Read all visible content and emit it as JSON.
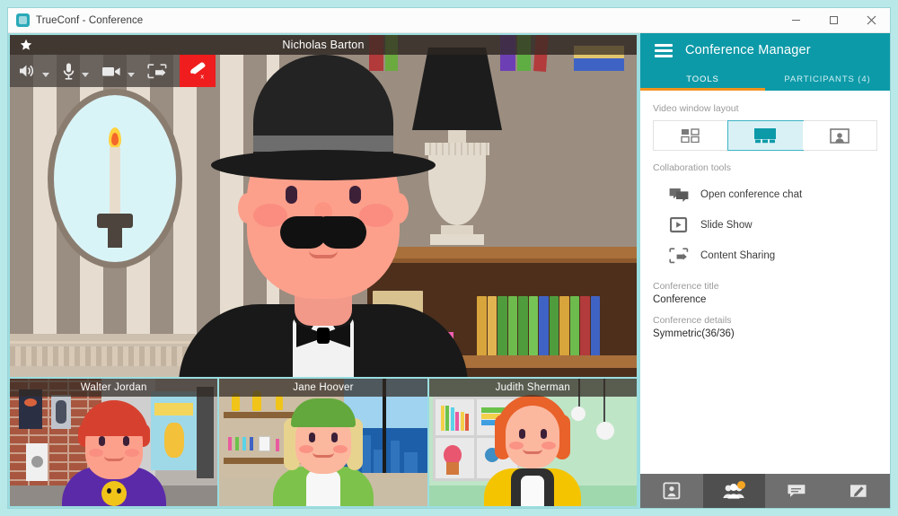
{
  "window": {
    "app_icon": "trueconf-logo-icon",
    "title": "TrueConf - Conference",
    "minimize_label": "–",
    "maximize_label": "□",
    "close_label": "✕"
  },
  "video_toolbar": {
    "star_icon": "star-icon",
    "speaker_icon": "speaker-icon",
    "microphone_icon": "microphone-icon",
    "camera_icon": "camera-icon",
    "screen_share_icon": "screen-share-icon",
    "hangup_icon": "hangup-icon"
  },
  "main_video": {
    "participant_name": "Nicholas Barton"
  },
  "thumbnails": [
    {
      "name": "Walter Jordan"
    },
    {
      "name": "Jane Hoover"
    },
    {
      "name": "Judith Sherman"
    }
  ],
  "conference_manager": {
    "menu_icon": "hamburger-menu-icon",
    "title": "Conference Manager",
    "tabs": [
      {
        "label": "TOOLS",
        "active": true
      },
      {
        "label": "PARTICIPANTS (4)",
        "active": false
      }
    ],
    "video_layout": {
      "section_label": "Video window layout",
      "options": [
        {
          "name": "layout-grid-icon",
          "selected": false
        },
        {
          "name": "layout-podium-icon",
          "selected": true
        },
        {
          "name": "layout-single-icon",
          "selected": false
        }
      ]
    },
    "collaboration": {
      "section_label": "Collaboration tools",
      "items": [
        {
          "label": "Open conference chat",
          "icon": "chat-icon"
        },
        {
          "label": "Slide Show",
          "icon": "slideshow-icon"
        },
        {
          "label": "Content Sharing",
          "icon": "content-sharing-icon"
        }
      ]
    },
    "details": {
      "title_label": "Conference title",
      "title_value": "Conference",
      "details_label": "Conference details",
      "details_value": "Symmetric(36/36)"
    },
    "footer_buttons": [
      {
        "name": "contacts-icon",
        "active": false,
        "badge": false
      },
      {
        "name": "groups-icon",
        "active": true,
        "badge": true
      },
      {
        "name": "chat-bubble-icon",
        "active": false,
        "badge": false
      },
      {
        "name": "compose-icon",
        "active": false,
        "badge": false
      }
    ]
  },
  "colors": {
    "accent_teal": "#0d9aa8",
    "frame_cyan": "#9bdde0",
    "tab_underline": "#f0941f",
    "hangup_red": "#ef1d1d",
    "selected_layout_bg": "#d9f1f5"
  }
}
